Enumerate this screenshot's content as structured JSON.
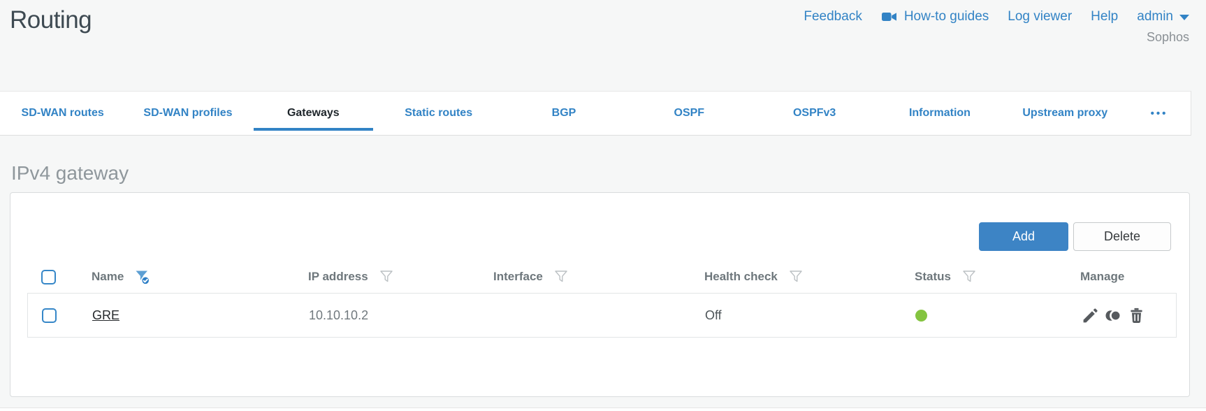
{
  "page": {
    "title": "Routing",
    "brand": "Sophos"
  },
  "header_links": [
    {
      "label": "Feedback"
    },
    {
      "label": "How-to guides",
      "icon": "video-camera"
    },
    {
      "label": "Log viewer"
    },
    {
      "label": "Help"
    },
    {
      "label": "admin",
      "icon": "caret-down"
    }
  ],
  "tabs": [
    {
      "label": "SD-WAN routes",
      "active": false
    },
    {
      "label": "SD-WAN profiles",
      "active": false
    },
    {
      "label": "Gateways",
      "active": true
    },
    {
      "label": "Static routes",
      "active": false
    },
    {
      "label": "BGP",
      "active": false
    },
    {
      "label": "OSPF",
      "active": false
    },
    {
      "label": "OSPFv3",
      "active": false
    },
    {
      "label": "Information",
      "active": false
    },
    {
      "label": "Upstream proxy",
      "active": false
    },
    {
      "label": "•••",
      "active": false,
      "icon": "ellipsis"
    }
  ],
  "section": {
    "heading": "IPv4 gateway"
  },
  "toolbar": {
    "add_label": "Add",
    "delete_label": "Delete"
  },
  "table": {
    "columns": [
      {
        "label": "Name",
        "filter": "applied"
      },
      {
        "label": "IP address",
        "filter": "available"
      },
      {
        "label": "Interface",
        "filter": "available"
      },
      {
        "label": "Health check",
        "filter": "available"
      },
      {
        "label": "Status",
        "filter": "available"
      },
      {
        "label": "Manage",
        "filter": "none"
      }
    ],
    "rows": [
      {
        "name": "GRE",
        "ip_address": "10.10.10.2",
        "interface": "",
        "health_check": "Off",
        "status": "up-green",
        "manage_icons": [
          "edit-pencil",
          "clone",
          "delete-trash"
        ]
      }
    ]
  },
  "colors": {
    "accent_blue": "#3283c5",
    "add_button_blue": "#3d84c5",
    "status_green": "#84c440",
    "active_tab_text": "#1f262b",
    "title_gray": "#3e4a52",
    "heading_gray": "#8f979c",
    "background": "#f6f7f7"
  }
}
